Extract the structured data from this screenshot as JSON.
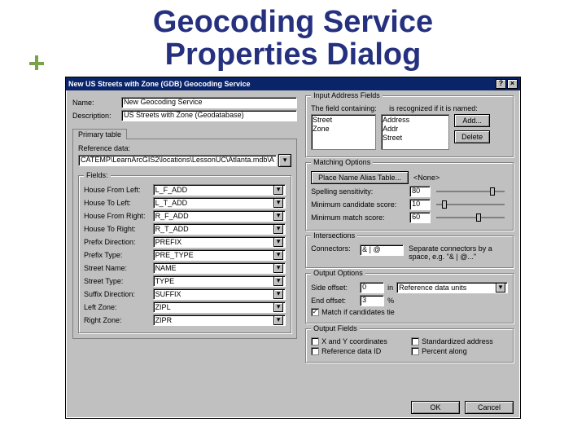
{
  "slide": {
    "title_l1": "Geocoding Service",
    "title_l2": "Properties Dialog"
  },
  "dialog": {
    "title": "New US Streets with Zone (GDB) Geocoding Service",
    "help": "?",
    "close": "×"
  },
  "left": {
    "name_label": "Name:",
    "name_value": "New Geocoding Service",
    "desc_label": "Description:",
    "desc_value": "US Streets with Zone (Geodatabase)",
    "tab": "Primary table",
    "refdata_label": "Reference data:",
    "refdata_value": "CATEMP\\LearnArcGIS2\\locations\\LessonUC\\Atlanta.mdb\\A",
    "fields_legend": "Fields:",
    "fields": [
      {
        "label": "House From Left:",
        "value": "L_F_ADD"
      },
      {
        "label": "House To Left:",
        "value": "L_T_ADD"
      },
      {
        "label": "House From Right:",
        "value": "R_F_ADD"
      },
      {
        "label": "House To Right:",
        "value": "R_T_ADD"
      },
      {
        "label": "Prefix Direction:",
        "value": "PREFIX"
      },
      {
        "label": "Prefix Type:",
        "value": "PRE_TYPE"
      },
      {
        "label": "Street Name:",
        "value": "NAME"
      },
      {
        "label": "Street Type:",
        "value": "TYPE"
      },
      {
        "label": "Suffix Direction:",
        "value": "SUFFIX"
      },
      {
        "label": "Left Zone:",
        "value": "ZIPL"
      },
      {
        "label": "Right Zone:",
        "value": "ZIPR"
      }
    ]
  },
  "right": {
    "inputfields_legend": "Input Address Fields",
    "field_containing": "The field containing:",
    "recognized": "is recognized if it is named:",
    "left_list": [
      "Street",
      "Zone"
    ],
    "right_list": [
      "Address",
      "Addr",
      "Street"
    ],
    "add": "Add...",
    "delete": "Delete",
    "matching_legend": "Matching Options",
    "place_btn": "Place Name Alias Table...",
    "place_value": "<None>",
    "spelling_label": "Spelling sensitivity:",
    "spelling_value": "80",
    "mincand_label": "Minimum candidate score:",
    "mincand_value": "10",
    "minmatch_label": "Minimum match score:",
    "minmatch_value": "60",
    "intersections_legend": "Intersections",
    "connectors_label": "Connectors:",
    "connectors_value": "& | @",
    "connectors_note1": "Separate connectors by a",
    "connectors_note2": "space, e.g. \"& | @...\"",
    "output_legend": "Output Options",
    "sideoffset_label": "Side offset:",
    "sideoffset_value": "0",
    "sideoffset_in": "in",
    "sideoffset_units": "Reference data units",
    "endoffset_label": "End offset:",
    "endoffset_value": "3",
    "endoffset_pct": "%",
    "matchif_label": "Match if candidates tie",
    "outfields_legend": "Output Fields",
    "xy_label": "X and Y coordinates",
    "std_label": "Standardized address",
    "refid_label": "Reference data ID",
    "pct_label": "Percent along"
  },
  "buttons": {
    "ok": "OK",
    "cancel": "Cancel"
  }
}
